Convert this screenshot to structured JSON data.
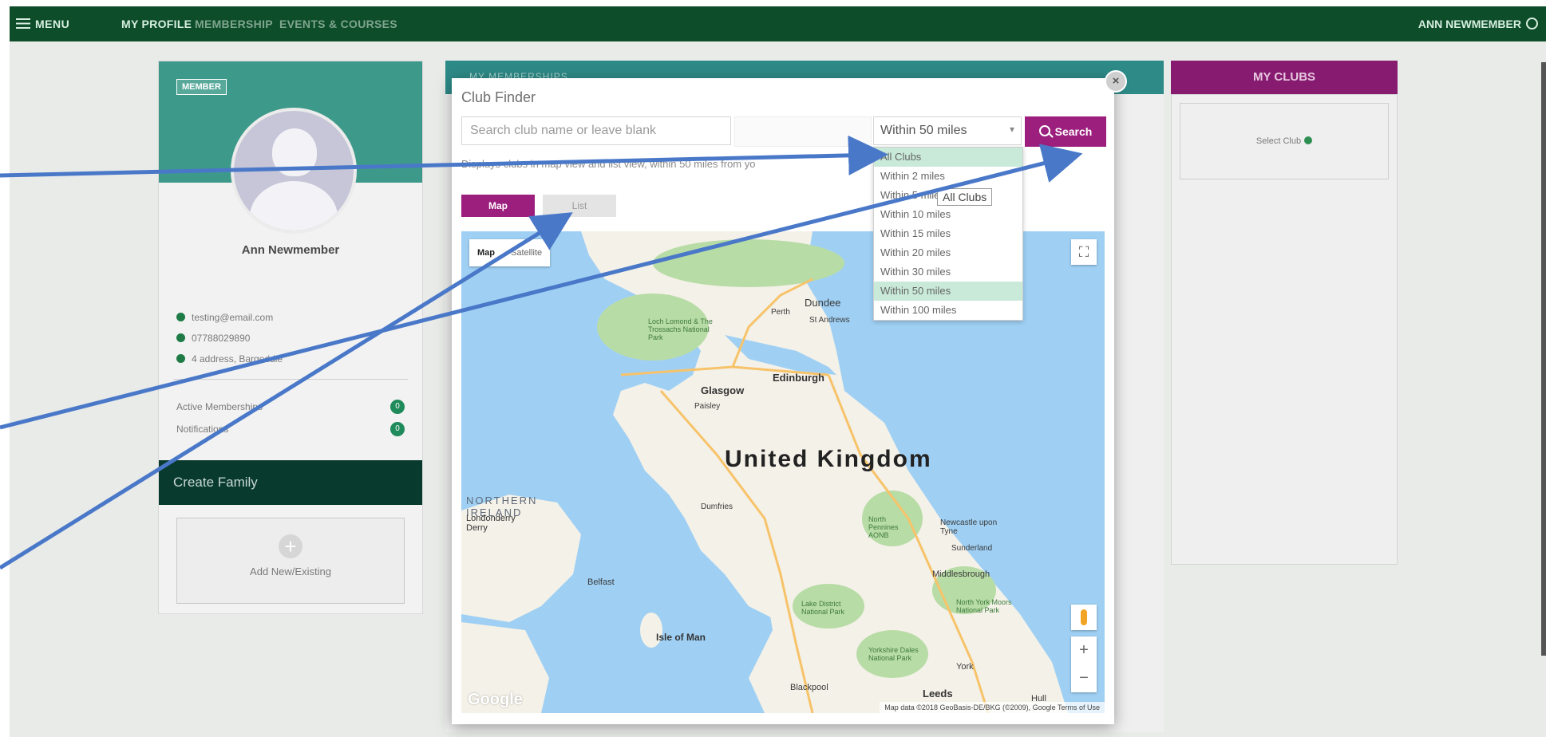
{
  "topnav": {
    "menu_label": "MENU",
    "items": [
      "MY PROFILE",
      "MEMBERSHIP",
      "EVENTS & COURSES"
    ],
    "user_label": "ANN NEWMEMBER"
  },
  "profile": {
    "badge": "MEMBER",
    "name": "Ann Newmember",
    "email": "testing@email.com",
    "phone": "07788029890",
    "address": "4 address, Bargeddie",
    "stats": [
      {
        "label": "Active Memberships",
        "count": "0"
      },
      {
        "label": "Notifications",
        "count": "0"
      }
    ],
    "family_title": "Create Family",
    "add_label": "Add New/Existing"
  },
  "background_panel": {
    "title": "MY MEMBERSHIPS"
  },
  "clubs": {
    "title": "MY CLUBS",
    "select_label": "Select Club"
  },
  "modal": {
    "title": "Club Finder",
    "search_placeholder": "Search club name or leave blank",
    "distance_selected": "Within 50 miles",
    "search_button": "Search",
    "helper_text": "Displays clubs in map view and list view, within 50 miles from yo",
    "tab_map": "Map",
    "tab_list": "List",
    "dropdown_options": [
      "All Clubs",
      "Within 2 miles",
      "Within 5 miles",
      "Within 10 miles",
      "Within 15 miles",
      "Within 20 miles",
      "Within 30 miles",
      "Within 50 miles",
      "Within 100 miles"
    ],
    "dropdown_highlighted": [
      "All Clubs",
      "Within 50 miles"
    ],
    "tooltip": "All Clubs"
  },
  "map": {
    "type_active": "Map",
    "type_inactive": "Satellite",
    "labels": {
      "country": "United Kingdom",
      "ni": "NORTHERN IRELAND",
      "glasgow": "Glasgow",
      "edinburgh": "Edinburgh",
      "dundee": "Dundee",
      "perth": "Perth",
      "standrews": "St Andrews",
      "paisley": "Paisley",
      "londonderry": "Londonderry Derry",
      "belfast": "Belfast",
      "isleofman": "Isle of Man",
      "newcastle": "Newcastle upon Tyne",
      "sunderland": "Sunderland",
      "middlesbrough": "Middlesbrough",
      "york": "York",
      "leeds": "Leeds",
      "blackpool": "Blackpool",
      "hull": "Hull",
      "dumfries": "Dumfries",
      "lochlomond": "Loch Lomond & The Trossachs National Park",
      "northumberland": "North Pennines AONB",
      "lakedistrict": "Lake District National Park",
      "yorkdales": "Yorkshire Dales National Park",
      "northyorkmoors": "North York Moors National Park"
    },
    "attribution": "Map data ©2018 GeoBasis-DE/BKG (©2009), Google  Terms of Use",
    "google": "Google"
  },
  "colors": {
    "nav": "#0d4d2a",
    "magenta": "#9c1f7e",
    "teal": "#3d9a8a",
    "arrow": "#4a78c8",
    "water": "#9fd0f4"
  }
}
